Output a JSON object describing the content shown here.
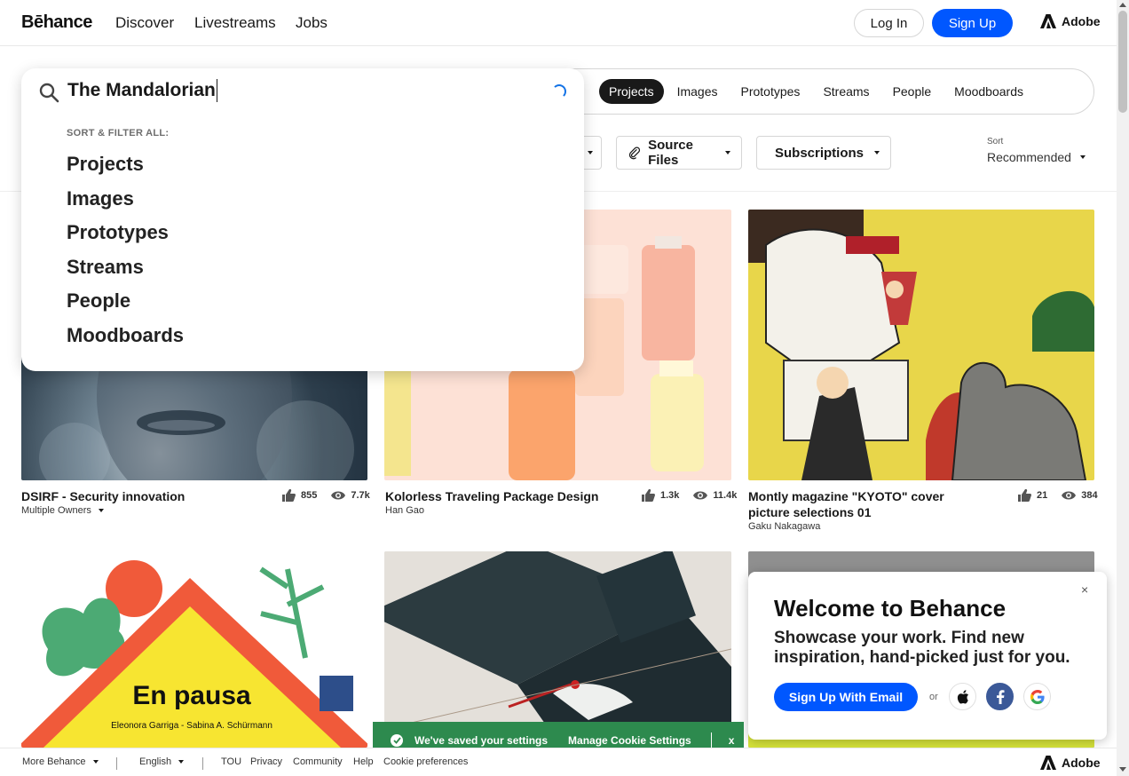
{
  "nav": {
    "logo": "Bēhance",
    "links": [
      "Discover",
      "Livestreams",
      "Jobs"
    ],
    "login": "Log In",
    "signup": "Sign Up",
    "adobe": "Adobe"
  },
  "search": {
    "query": "The Mandalorian",
    "chips": [
      "Projects",
      "Images",
      "Prototypes",
      "Streams",
      "People",
      "Moodboards"
    ],
    "active_chip": "Projects"
  },
  "filters": {
    "source_files": "Source Files",
    "subscriptions": "Subscriptions",
    "sort_label": "Sort",
    "sort_value": "Recommended"
  },
  "dropdown": {
    "label": "SORT & FILTER ALL:",
    "items": [
      "Projects",
      "Images",
      "Prototypes",
      "Streams",
      "People",
      "Moodboards"
    ]
  },
  "projects": [
    {
      "title": "DSIRF - Security innovation",
      "owner": "Multiple Owners",
      "likes": "855",
      "views": "7.7k"
    },
    {
      "title": "Kolorless Traveling Package Design",
      "owner": "Han Gao",
      "likes": "1.3k",
      "views": "11.4k"
    },
    {
      "title": "Montly magazine \"KYOTO\" cover picture selections 01",
      "owner": "Gaku Nakagawa",
      "likes": "21",
      "views": "384"
    }
  ],
  "artwork": {
    "pausa_title": "En pausa",
    "pausa_authors": "Eleonora Garriga - Sabina A. Schürmann"
  },
  "welcome": {
    "title": "Welcome to Behance",
    "text": "Showcase your work. Find new inspiration, hand-picked just for you.",
    "email_button": "Sign Up With Email",
    "or": "or",
    "close": "×"
  },
  "toast": {
    "message": "We've saved your settings",
    "manage": "Manage Cookie Settings",
    "close": "x"
  },
  "footer": {
    "more": "More Behance",
    "language": "English",
    "links": [
      "TOU",
      "Privacy",
      "Community",
      "Help",
      "Cookie preferences"
    ],
    "adobe": "Adobe"
  },
  "colors": {
    "brand_blue": "#0057ff",
    "toast_green": "#2d8a4e",
    "spinner_blue": "#1473e6"
  }
}
